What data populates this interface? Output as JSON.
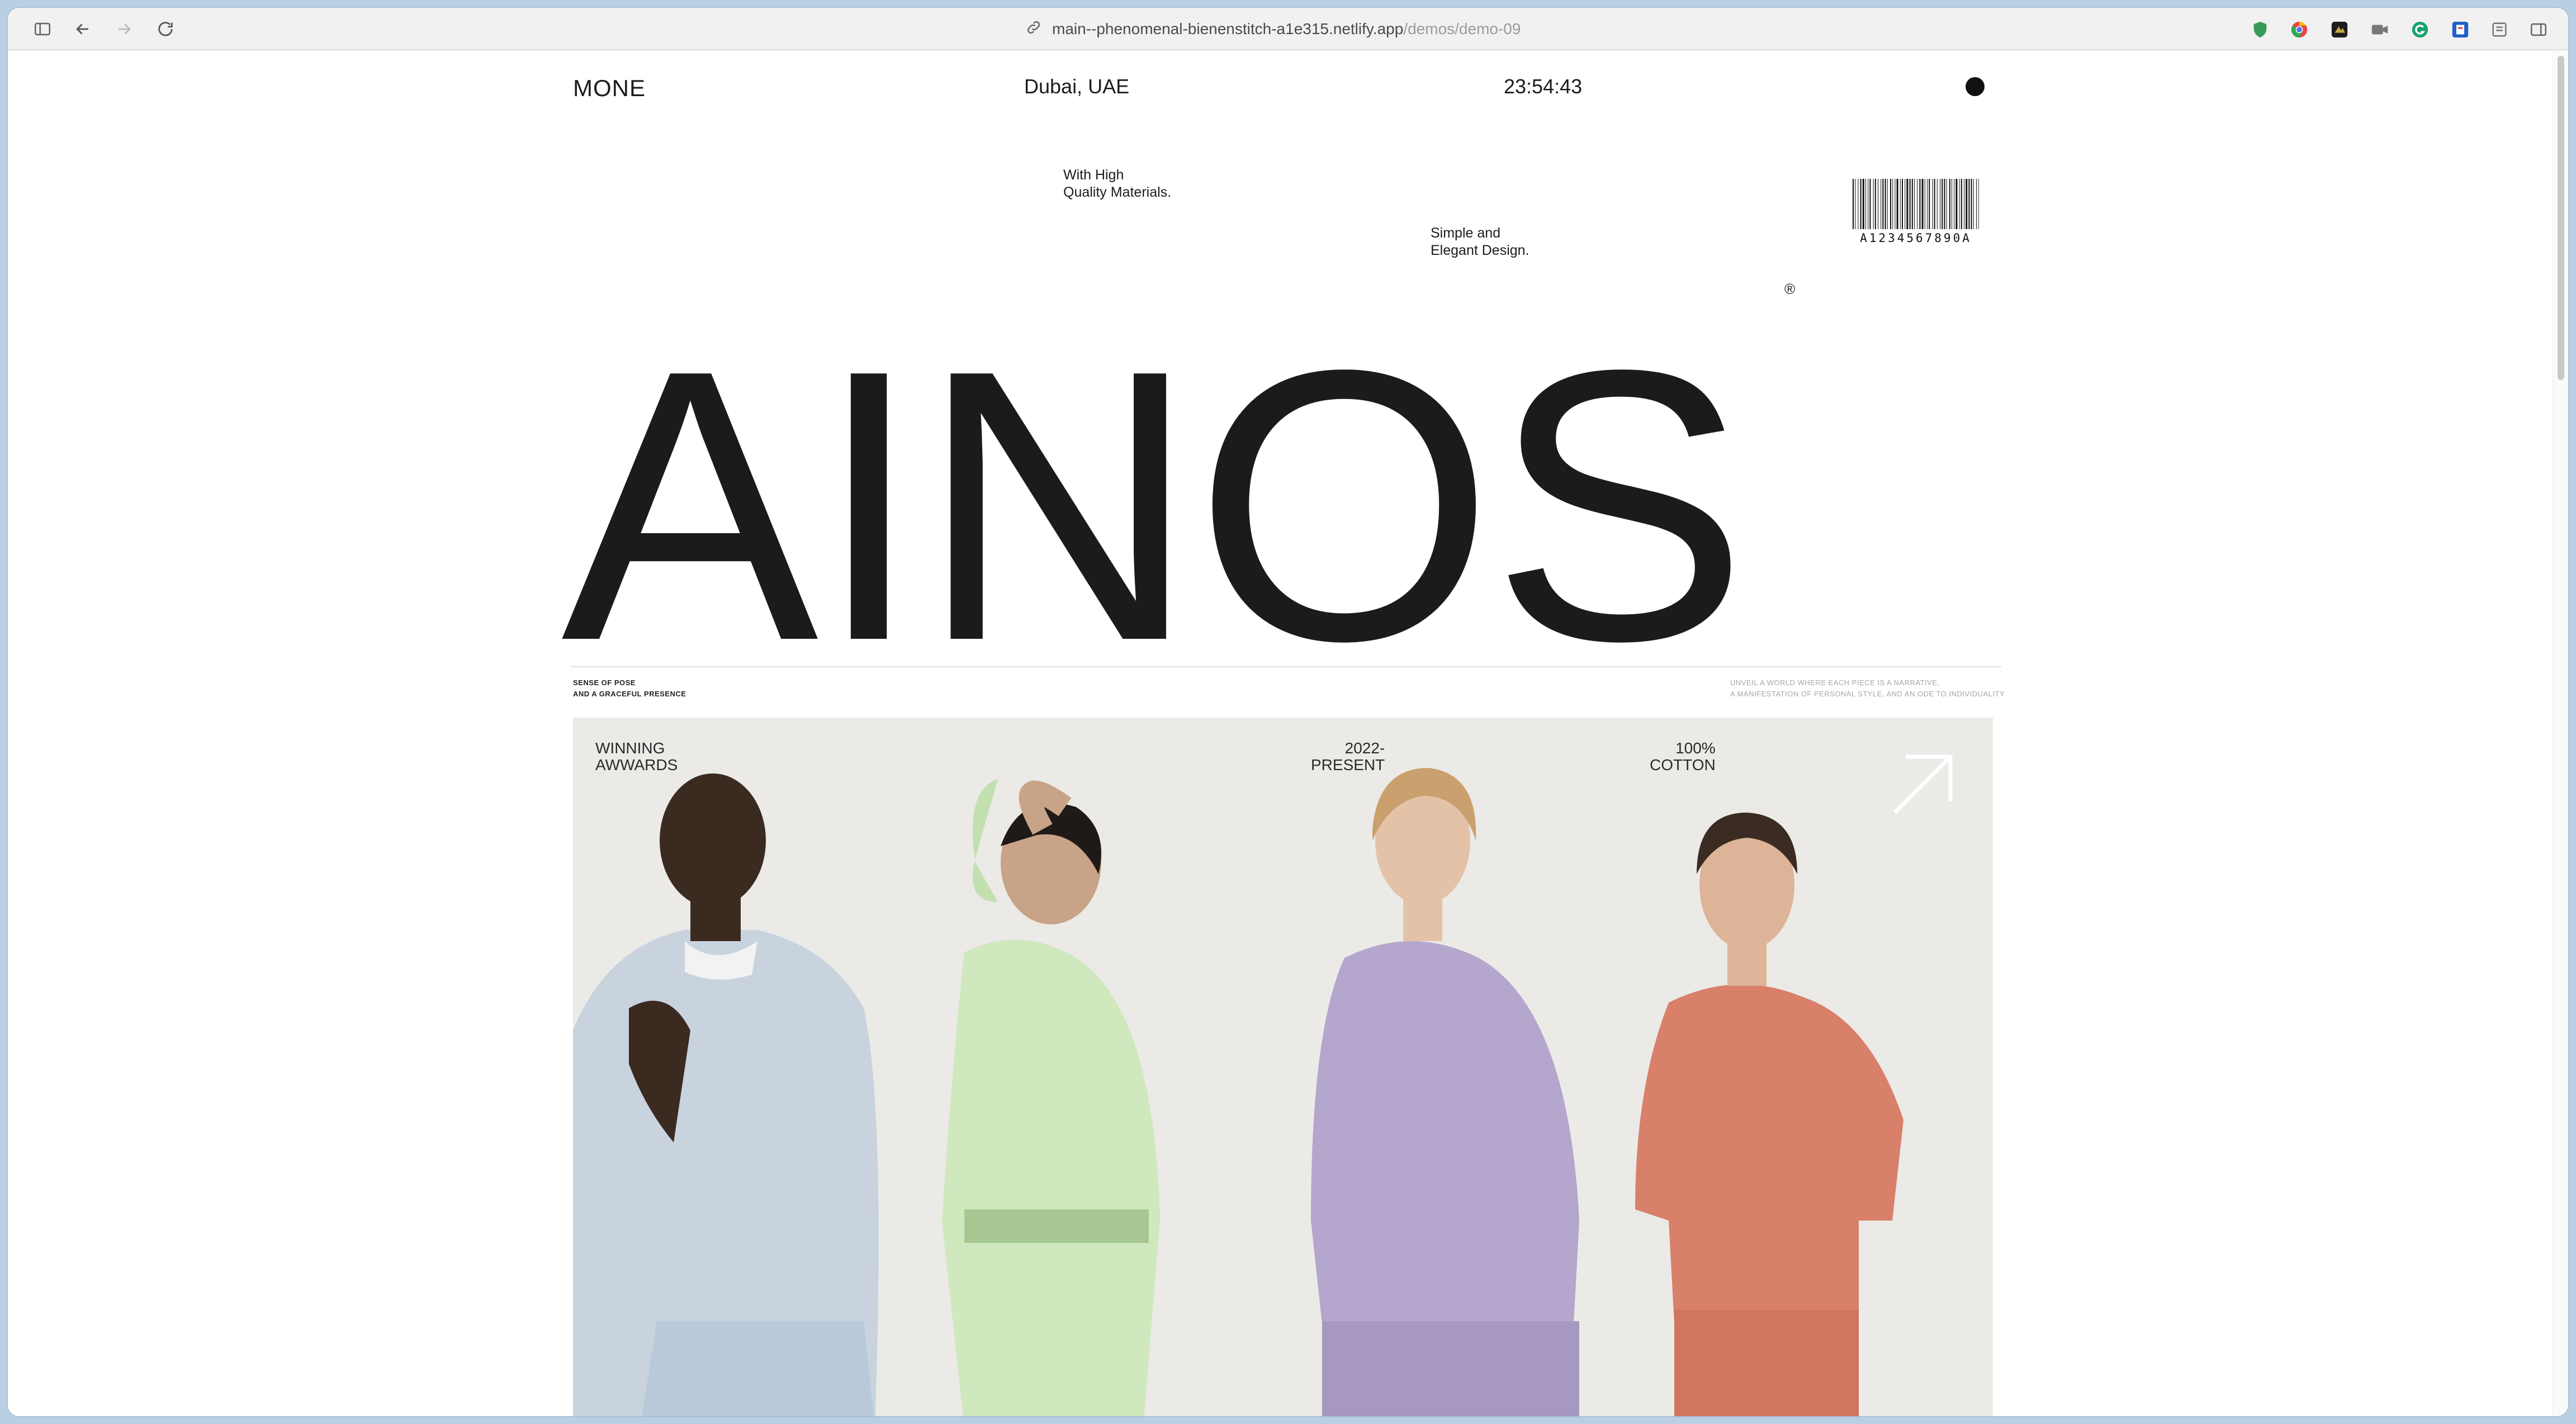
{
  "browser": {
    "url_host": "main--phenomenal-bienenstitch-a1e315.netlify.app",
    "url_path": "/demos/demo-09",
    "icons": [
      "sidebar-icon",
      "back-icon",
      "forward-icon",
      "reload-icon",
      "link-icon"
    ],
    "extensions": [
      "shield-extension-icon",
      "chrome-extension-icon",
      "dark-extension-icon",
      "camera-extension-icon",
      "grammarly-extension-icon",
      "blue-extension-icon",
      "reader-icon",
      "sidebar-right-icon"
    ]
  },
  "header": {
    "brand": "MONE",
    "location": "Dubai, UAE",
    "time": "23:54:43",
    "menu_icon": "dot-menu-icon"
  },
  "notes": {
    "note1_line1": "With High",
    "note1_line2": "Quality Materials.",
    "note2_line1": "Simple and",
    "note2_line2": "Elegant Design."
  },
  "barcode": {
    "number": "A1234567890A"
  },
  "registered_mark": "®",
  "hero": {
    "title": "AINOS"
  },
  "tagline_left": {
    "line1": "SENSE OF POSE",
    "line2": "AND A GRACEFUL PRESENCE"
  },
  "tagline_right": {
    "line1": "UNVEIL A WORLD WHERE EACH PIECE IS A NARRATIVE,",
    "line2": "A MANIFESTATION OF PERSONAL STYLE, AND AN ODE TO INDIVIDUALITY"
  },
  "stats": [
    {
      "line1": "WINNING",
      "line2": "AWWARDS"
    },
    {
      "line1": "2022-",
      "line2": "PRESENT"
    },
    {
      "line1": "100%",
      "line2": "COTTON"
    }
  ],
  "colors": {
    "hoodie_blue": "#c8d3de",
    "hoodie_green": "#cfe8bd",
    "sweater_lilac": "#b4a6cc",
    "tee_coral": "#d8806a"
  }
}
